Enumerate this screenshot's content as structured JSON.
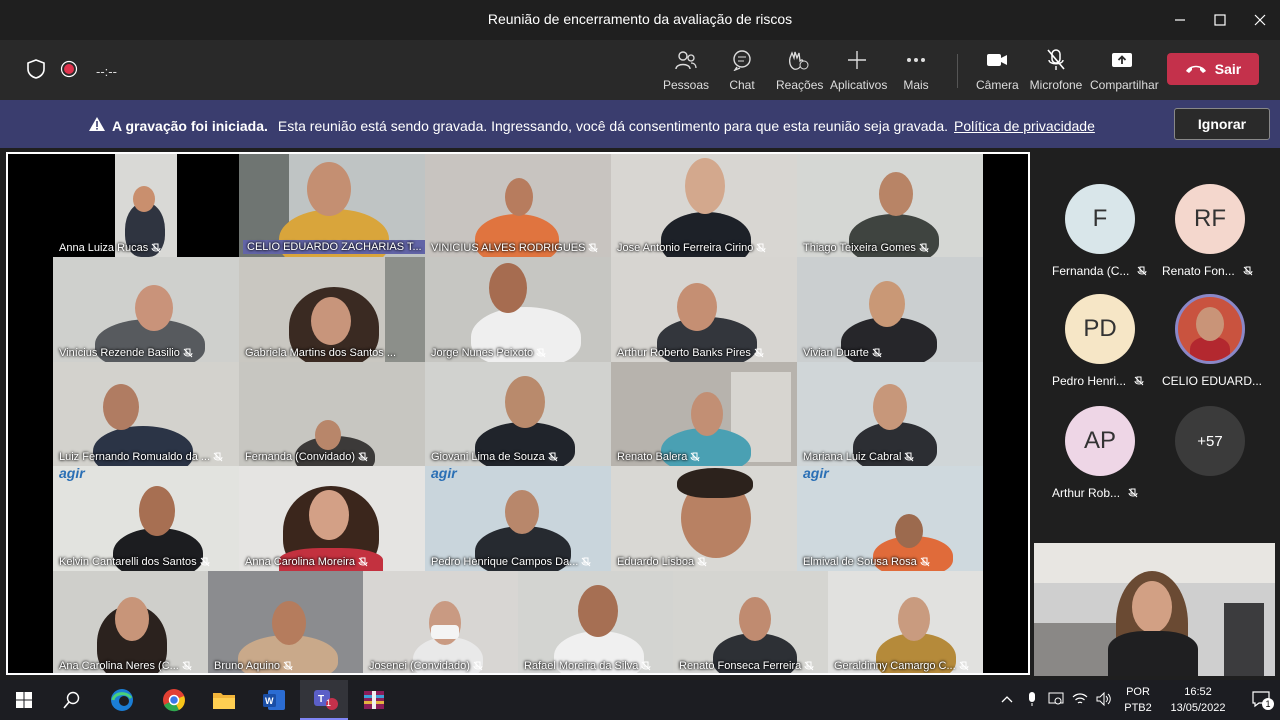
{
  "window": {
    "title": "Reunião de encerramento da avaliação de riscos",
    "controls": [
      "minimize",
      "maximize",
      "close"
    ]
  },
  "toolbar": {
    "timer": "--:--",
    "buttons": [
      {
        "label": "Pessoas",
        "icon": "people-icon"
      },
      {
        "label": "Chat",
        "icon": "chat-icon"
      },
      {
        "label": "Reações",
        "icon": "reactions-icon"
      },
      {
        "label": "Aplicativos",
        "icon": "plus-icon"
      },
      {
        "label": "Mais",
        "icon": "more-icon"
      },
      {
        "label": "Câmera",
        "icon": "camera-icon"
      },
      {
        "label": "Microfone",
        "icon": "mic-off-icon"
      },
      {
        "label": "Compartilhar",
        "icon": "share-icon"
      }
    ],
    "leave_label": "Sair",
    "leave_color": "#c4314b"
  },
  "banner": {
    "bold": "A gravação foi iniciada.",
    "text": "Esta reunião está sendo gravada. Ingressando, você dá consentimento para que esta reunião seja gravada.",
    "link": "Política de privacidade",
    "ignore_label": "Ignorar",
    "color": "#3a3d6e"
  },
  "participants": [
    {
      "name": "Anna Luiza Rucas"
    },
    {
      "name": "CELIO EDUARDO ZACHARIAS T..."
    },
    {
      "name": "VINICIUS ALVES RODRIGUES"
    },
    {
      "name": "Jose Antonio Ferreira Cirino"
    },
    {
      "name": "Thiago Teixeira Gomes"
    },
    {
      "name": "Vinícius Rezende Basilio"
    },
    {
      "name": "Gabriela Martins dos Santos ..."
    },
    {
      "name": "Jorge Nunes Peixoto"
    },
    {
      "name": "Arthur Roberto Banks Pires"
    },
    {
      "name": "Vivian Duarte"
    },
    {
      "name": "Luiz Fernando Romualdo da ..."
    },
    {
      "name": "Fernanda (Convidado)"
    },
    {
      "name": "Giovani Lima de Souza"
    },
    {
      "name": "Renato Balera"
    },
    {
      "name": "Mariana Luiz Cabral"
    },
    {
      "name": "Kelvin Cantarelli dos Santos"
    },
    {
      "name": "Anna Carolina Moreira"
    },
    {
      "name": "Pedro Henrique Campos Da..."
    },
    {
      "name": "Eduardo Lisboa"
    },
    {
      "name": "Elmival de Sousa Rosa"
    },
    {
      "name": "Ana Carolina Neres (C..."
    },
    {
      "name": "Bruno Aquino"
    },
    {
      "name": "Josenei (Convidado)"
    },
    {
      "name": "Rafael Moreira da Silva"
    },
    {
      "name": "Renato Fonseca Ferreira"
    },
    {
      "name": "Geraldinny Camargo C..."
    }
  ],
  "logo_text": "agir",
  "roster": [
    {
      "initials": "F",
      "name": "Fernanda (C...",
      "color": "#d9e6ea"
    },
    {
      "initials": "RF",
      "name": "Renato Fon...",
      "color": "#f4d7cd"
    },
    {
      "initials": "PD",
      "name": "Pedro Henri...",
      "color": "#f6e6c6"
    },
    {
      "initials": "",
      "name": "CELIO EDUARD...",
      "color": "#8a87c7"
    },
    {
      "initials": "AP",
      "name": "Arthur Rob...",
      "color": "#eed6e6"
    },
    {
      "initials": "+57",
      "name": "",
      "color": "#3b3b3b"
    }
  ],
  "taskbar": {
    "apps": [
      "windows-start-icon",
      "search-icon",
      "edge-icon",
      "chrome-icon",
      "file-explorer-icon",
      "word-icon",
      "teams-icon",
      "winrar-icon"
    ],
    "teams_badge": "1",
    "lang_top": "POR",
    "lang_bottom": "PTB2",
    "time": "16:52",
    "date": "13/05/2022",
    "notif_count": "1"
  }
}
